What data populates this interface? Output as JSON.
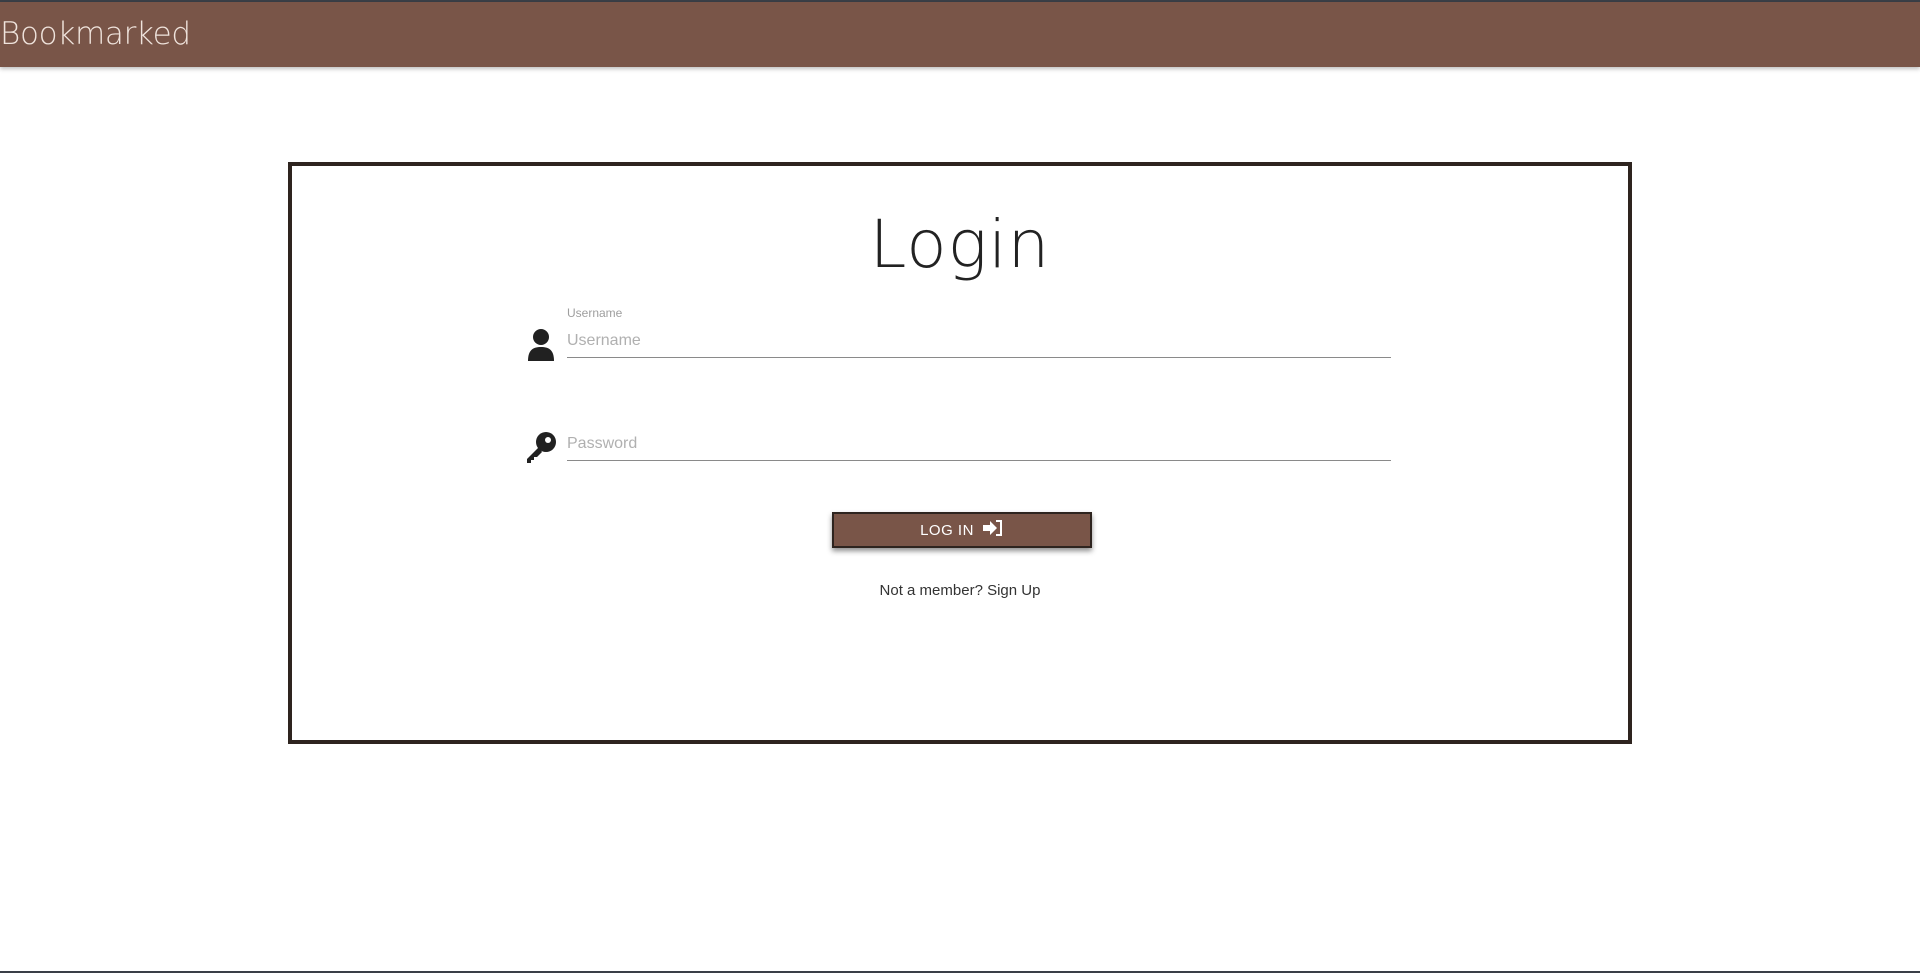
{
  "navbar": {
    "brand": "Bookmarked",
    "color": "#795548"
  },
  "login": {
    "title": "Login",
    "username": {
      "label": "Username",
      "placeholder": "Username",
      "value": "",
      "icon": "user-icon"
    },
    "password": {
      "placeholder": "Password",
      "value": "",
      "icon": "key-icon"
    },
    "submit_label": "LOG IN",
    "submit_icon": "sign-in-icon",
    "signup_prompt": "Not a member?",
    "signup_link": "Sign Up"
  },
  "colors": {
    "accent": "#795548",
    "border": "#2e241f"
  }
}
